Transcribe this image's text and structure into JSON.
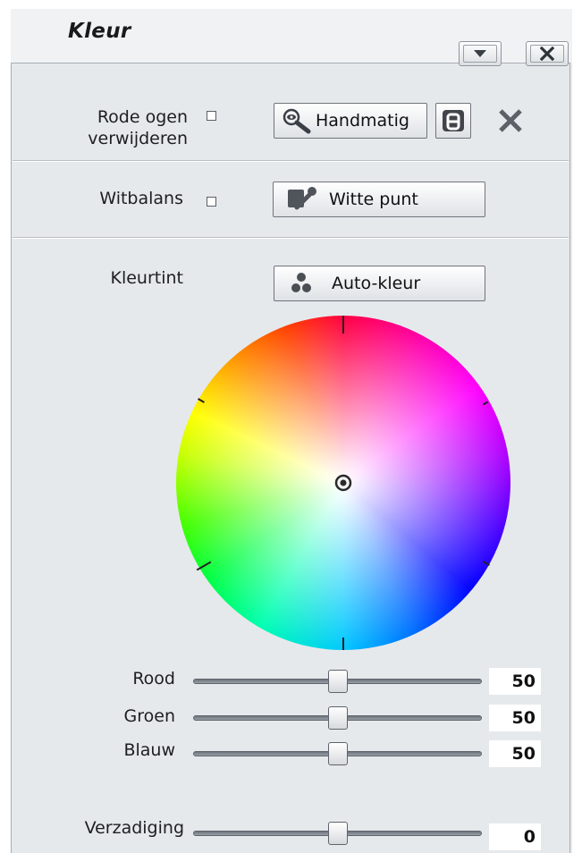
{
  "panel": {
    "title": "Kleur"
  },
  "red_eye": {
    "label": "Rode ogen verwijderen",
    "label_line1": "Rode ogen",
    "label_line2": "verwijderen",
    "checked": false,
    "manual_button": "Handmatig"
  },
  "white_balance": {
    "label": "Witbalans",
    "checked": false,
    "white_point_button": "Witte punt"
  },
  "tint": {
    "label": "Kleurtint",
    "auto_color_button": "Auto-kleur"
  },
  "sliders": [
    {
      "label": "Rood",
      "value": "50",
      "level": 0.5
    },
    {
      "label": "Groen",
      "value": "50",
      "level": 0.5
    },
    {
      "label": "Blauw",
      "value": "50",
      "level": 0.5
    }
  ],
  "saturation": {
    "label": "Verzadiging",
    "value": "0",
    "level": 0.5
  },
  "icons": {
    "collapse": "chevron-down-icon",
    "close_panel": "close-icon",
    "manual": "magnifier-eye-icon",
    "auto": "auto-a-icon",
    "reset": "close-x-icon",
    "white_point": "eyedropper-icon",
    "auto_color": "color-dots-icon"
  },
  "colors": {
    "panel_bg": "#e6e9ec",
    "reset_x": "#5c6168"
  }
}
